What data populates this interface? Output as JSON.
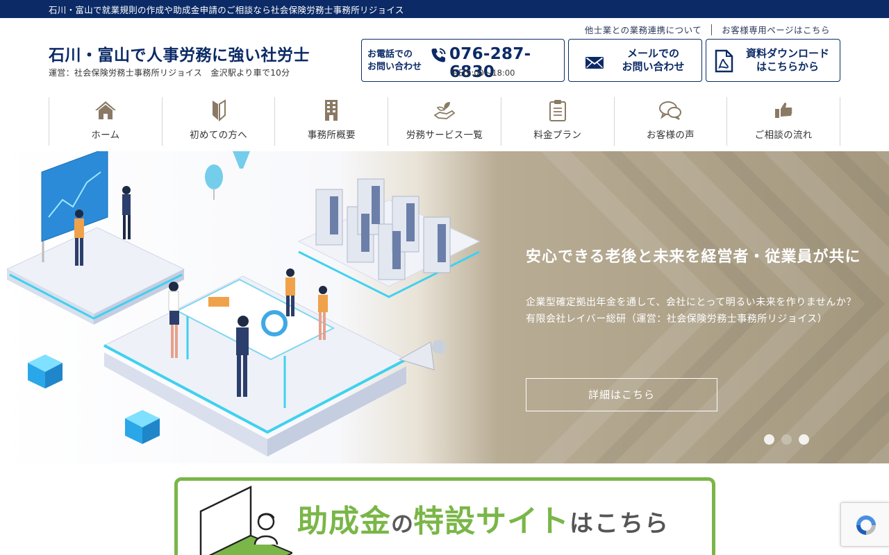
{
  "topbar": {
    "text": "石川・富山で就業規則の作成や助成金申請のご相談なら社会保険労務士事務所リジョイス"
  },
  "util_links": {
    "partner": "他士業との業務連携について",
    "client": "お客様専用ページはこちら"
  },
  "brand": {
    "title": "石川・富山で人事労務に強い社労士",
    "subtitle": "運営：社会保険労務士事務所リジョイス　金沢駅より車で10分"
  },
  "contact": {
    "phone_label_line1": "お電話での",
    "phone_label_line2": "お問い合わせ",
    "phone_number": "076-287-6830",
    "phone_hours": "平日9:00～18:00",
    "mail_line1": "メールでの",
    "mail_line2": "お問い合わせ",
    "download_line1": "資料ダウンロード",
    "download_line2": "はこちらから"
  },
  "nav": {
    "items": [
      {
        "label": "ホーム",
        "icon": "home-icon"
      },
      {
        "label": "初めての方へ",
        "icon": "beginner-mark-icon"
      },
      {
        "label": "事務所概要",
        "icon": "building-icon"
      },
      {
        "label": "労務サービス一覧",
        "icon": "hand-plant-icon"
      },
      {
        "label": "料金プラン",
        "icon": "clipboard-icon"
      },
      {
        "label": "お客様の声",
        "icon": "speech-bubbles-icon"
      },
      {
        "label": "ご相談の流れ",
        "icon": "thumbs-up-icon"
      }
    ]
  },
  "hero": {
    "title": "安心できる老後と未来を経営者・従業員が共に",
    "text_line1": "企業型確定拠出年金を通して、会社にとって明るい未来を作りませんか？",
    "text_line2": "有限会社レイバー総研（運営：社会保険労務士事務所リジョイス）",
    "button": "詳細はこちら",
    "slides_total": 3,
    "active_slide": 1
  },
  "banner": {
    "part1": "助成金",
    "part2": "の",
    "part3": "特設サイト",
    "part4": "はこちら"
  },
  "colors": {
    "navy": "#0b2a66",
    "green": "#7ab648",
    "hero_tan": "#a4987f",
    "nav_icon": "#8a7a64"
  }
}
